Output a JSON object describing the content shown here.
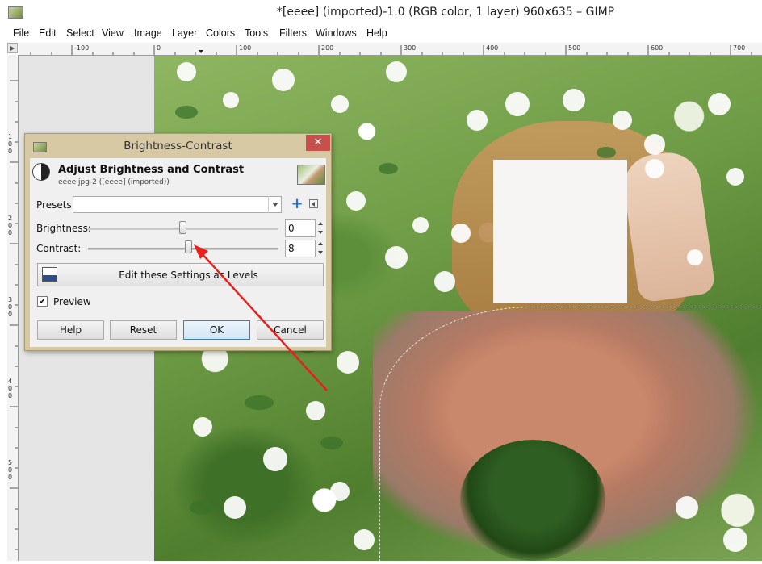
{
  "window": {
    "title": "*[eeee] (imported)-1.0 (RGB color, 1 layer) 960x635 – GIMP"
  },
  "menubar": {
    "items": [
      "File",
      "Edit",
      "Select",
      "View",
      "Image",
      "Layer",
      "Colors",
      "Tools",
      "Filters",
      "Windows",
      "Help"
    ]
  },
  "rulers": {
    "horizontal_labels": [
      "-100",
      "0",
      "100",
      "200",
      "300",
      "400",
      "500",
      "600",
      "700"
    ],
    "vertical_labels": [
      "1\n0\n0",
      "2\n0\n0",
      "3\n0\n0",
      "4\n0\n0",
      "5\n0\n0"
    ]
  },
  "dialog": {
    "title": "Brightness-Contrast",
    "close_label": "✕",
    "header_title": "Adjust Brightness and Contrast",
    "header_subtitle": "eeee.jpg-2 ([eeee] (imported))",
    "presets_label": "Presets:",
    "presets_value": "",
    "brightness_label": "Brightness:",
    "brightness_value": "0",
    "contrast_label": "Contrast:",
    "contrast_value": "8",
    "levels_button_label": "Edit these Settings as Levels",
    "preview_label": "Preview",
    "preview_checked": true,
    "check_glyph": "✔",
    "buttons": {
      "help": "Help",
      "reset": "Reset",
      "ok": "OK",
      "cancel": "Cancel"
    }
  },
  "annotation": {
    "arrow_color": "#e8201c"
  },
  "colors": {
    "dialog_frame": "#d7c9a4",
    "close_button": "#c7504a",
    "ok_border": "#3c7fb1"
  }
}
